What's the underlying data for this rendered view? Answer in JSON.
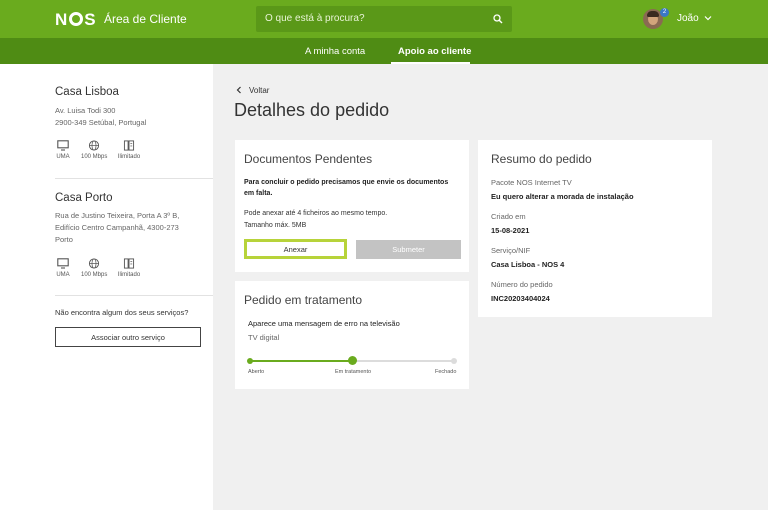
{
  "header": {
    "brand": "NOS",
    "title": "Área de Cliente",
    "search_placeholder": "O que está à procura?",
    "notifications": "2",
    "user_name": "João"
  },
  "nav": {
    "items": [
      {
        "label": "A minha conta"
      },
      {
        "label": "Apoio ao cliente"
      }
    ],
    "active": "Apoio ao cliente"
  },
  "sidebar": {
    "locations": [
      {
        "name": "Casa Lisboa",
        "address_line1": "Av. Luisa Todi 300",
        "address_line2": "2900-349 Setúbal, Portugal",
        "services": [
          {
            "icon": "tv-icon",
            "label": "UMA"
          },
          {
            "icon": "globe-icon",
            "label": "100 Mbps"
          },
          {
            "icon": "phone-icon",
            "label": "Ilimitado"
          }
        ]
      },
      {
        "name": "Casa Porto",
        "address_line1": "Rua de Justino Teixeira, Porta A 3º B,",
        "address_line2": "Edifício Centro Campanhã, 4300-273",
        "address_line3": "Porto",
        "services": [
          {
            "icon": "tv-icon",
            "label": "UMA"
          },
          {
            "icon": "globe-icon",
            "label": "100 Mbps"
          },
          {
            "icon": "phone-icon",
            "label": "Ilimitado"
          }
        ]
      }
    ],
    "missing_text": "Não encontra algum dos seus serviços?",
    "associate_button": "Associar outro serviço"
  },
  "main": {
    "back_label": "Voltar",
    "page_title": "Detalhes do pedido",
    "pending_docs": {
      "title": "Documentos Pendentes",
      "message_line1": "Para concluir o pedido precisamos que envie os documentos",
      "message_line2": "em falta.",
      "info_line1": "Pode anexar até 4 ficheiros ao mesmo tempo.",
      "info_line2": "Tamanho máx. 5MB",
      "attach_button": "Anexar",
      "submit_button": "Submeter"
    },
    "treatment": {
      "title": "Pedido em tratamento",
      "issue": "Aparece uma mensagem de erro na televisão",
      "service": "TV digital",
      "steps": [
        "Aberto",
        "Em tratamento",
        "Fechado"
      ],
      "current_step": "Em tratamento"
    },
    "summary": {
      "title": "Resumo do pedido",
      "fields": [
        {
          "label": "Pacote NOS Internet TV",
          "value": "Eu quero alterar a morada de instalação"
        },
        {
          "label": "Criado em",
          "value": "15-08-2021"
        },
        {
          "label": "Serviço/NIF",
          "value": "Casa Lisboa - NOS 4"
        },
        {
          "label": "Número do pedido",
          "value": "INC20203404024"
        }
      ]
    }
  },
  "colors": {
    "brand_green": "#6aab1e",
    "nav_green": "#4f8c14",
    "accent_lime": "#b7d33a",
    "disabled_gray": "#c3c3c3"
  }
}
